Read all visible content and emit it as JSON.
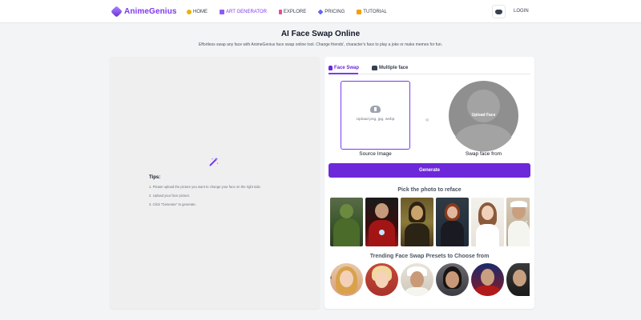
{
  "header": {
    "logo_text": "AnimeGenius",
    "nav": [
      {
        "label": "HOME",
        "icon": "home-icon",
        "active": false
      },
      {
        "label": "ART GENERATOR",
        "icon": "art-generator-icon",
        "active": true
      },
      {
        "label": "EXPLORE",
        "icon": "explore-icon",
        "active": false
      },
      {
        "label": "PRICING",
        "icon": "pricing-icon",
        "active": false
      },
      {
        "label": "TUTORIAL",
        "icon": "tutorial-icon",
        "active": false
      }
    ],
    "discord_icon": "discord-icon",
    "login_label": "LOGIN"
  },
  "page": {
    "title": "AI Face Swap Online",
    "subtitle": "Effortless swap any face with AnimeGenius face swap online tool. Change friends', character's face to play a joke or make memes for fun."
  },
  "tips": {
    "title": "Tips:",
    "items": [
      "1. Please upload the picture you want to change your face on the right side.",
      "2. Upload your face picture.",
      "3. Click \"Generate\" to generate."
    ]
  },
  "tabs": [
    {
      "label": "Face Swap",
      "active": true
    },
    {
      "label": "Multiple face",
      "active": false
    }
  ],
  "source": {
    "hint": "Upload png, jpg, webp",
    "label": "Source Image"
  },
  "swap_arrows": "«",
  "face": {
    "hint": "Upload Face",
    "label": "Swap face from"
  },
  "generate_label": "Generate",
  "refs_title": "Pick the photo to reface",
  "presets_title": "Trending Face Swap Presets to Choose from",
  "refs_next": "›",
  "presets_prev": "‹",
  "presets_next": "›",
  "colors": {
    "accent": "#6d28d9",
    "accent_light": "#7c3aed",
    "background": "#f3f4f6"
  }
}
